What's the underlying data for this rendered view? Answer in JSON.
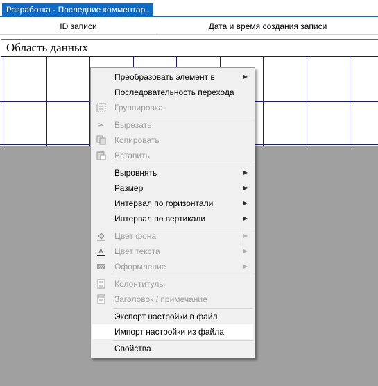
{
  "tab": {
    "title": "Разработка - Последние комментар..."
  },
  "header": {
    "col1": "ID записи",
    "col2": "Дата и время создания записи"
  },
  "section": {
    "title": "Область данных"
  },
  "menu": {
    "items": [
      {
        "label": "Преобразовать элемент в",
        "submenu": true,
        "disabled": false
      },
      {
        "label": "Последовательность перехода",
        "submenu": false,
        "disabled": false
      },
      {
        "label": "Группировка",
        "submenu": false,
        "disabled": true,
        "icon": "grouping-icon"
      },
      {
        "label": "Вырезать",
        "submenu": false,
        "disabled": true,
        "icon": "scissors-icon"
      },
      {
        "label": "Копировать",
        "submenu": false,
        "disabled": true,
        "icon": "copy-icon"
      },
      {
        "label": "Вставить",
        "submenu": false,
        "disabled": true,
        "icon": "paste-icon"
      },
      {
        "label": "Выровнять",
        "submenu": true,
        "disabled": false
      },
      {
        "label": "Размер",
        "submenu": true,
        "disabled": false
      },
      {
        "label": "Интервал по горизонтали",
        "submenu": true,
        "disabled": false
      },
      {
        "label": "Интервал по вертикали",
        "submenu": true,
        "disabled": false
      },
      {
        "label": "Цвет фона",
        "submenu": true,
        "disabled": true,
        "icon": "fill-color-icon"
      },
      {
        "label": "Цвет текста",
        "submenu": true,
        "disabled": true,
        "icon": "font-color-icon"
      },
      {
        "label": "Оформление",
        "submenu": true,
        "disabled": true,
        "icon": "special-effect-icon"
      },
      {
        "label": "Колонтитулы",
        "submenu": false,
        "disabled": true,
        "icon": "page-header-icon"
      },
      {
        "label": "Заголовок / примечание",
        "submenu": false,
        "disabled": true,
        "icon": "form-header-icon"
      },
      {
        "label": "Экспорт настройки в файл",
        "submenu": false,
        "disabled": false
      },
      {
        "label": "Импорт настройки из файла",
        "submenu": false,
        "disabled": false,
        "highlighted": true
      },
      {
        "label": "Свойства",
        "submenu": false,
        "disabled": false
      }
    ]
  },
  "colors": {
    "tab_bg": "#0e6ac4",
    "grid_line": "#1a1a8c",
    "canvas_bg": "#a0a0a0",
    "menu_bg": "#f0f0f0"
  }
}
